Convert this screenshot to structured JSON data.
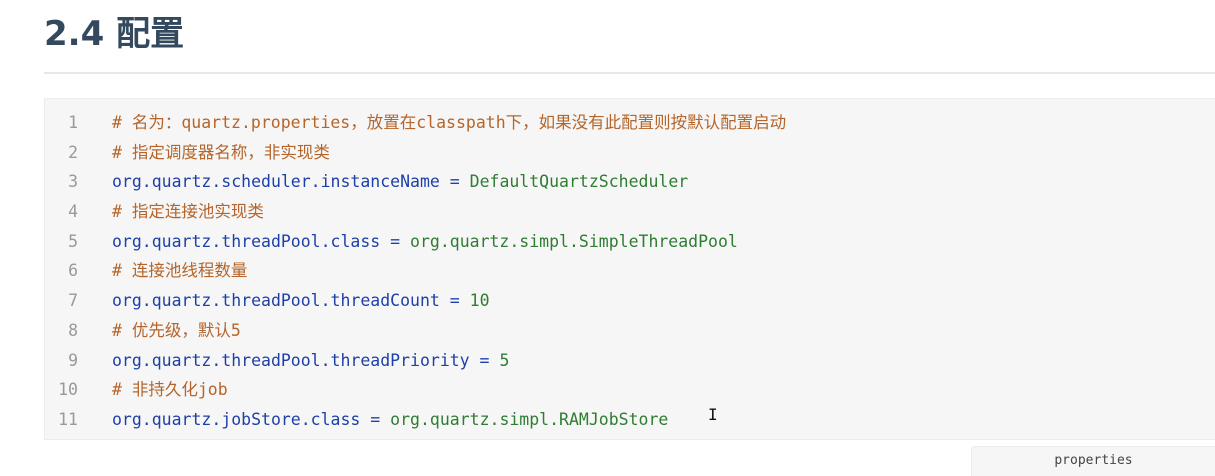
{
  "heading": {
    "title": "2.4 配置"
  },
  "code_block": {
    "language_label": "properties",
    "lines": [
      {
        "number": "1",
        "kind": "comment",
        "text": "# 名为：quartz.properties，放置在classpath下，如果没有此配置则按默认配置启动"
      },
      {
        "number": "2",
        "kind": "comment",
        "text": "# 指定调度器名称，非实现类"
      },
      {
        "number": "3",
        "kind": "property",
        "key": "org.quartz.scheduler.instanceName",
        "op": " = ",
        "value": "DefaultQuartzScheduler"
      },
      {
        "number": "4",
        "kind": "comment",
        "text": "# 指定连接池实现类"
      },
      {
        "number": "5",
        "kind": "property",
        "key": "org.quartz.threadPool.class",
        "op": " = ",
        "value": "org.quartz.simpl.SimpleThreadPool"
      },
      {
        "number": "6",
        "kind": "comment",
        "text": "# 连接池线程数量"
      },
      {
        "number": "7",
        "kind": "property",
        "key": "org.quartz.threadPool.threadCount",
        "op": " = ",
        "value": "10"
      },
      {
        "number": "8",
        "kind": "comment",
        "text": "# 优先级，默认5"
      },
      {
        "number": "9",
        "kind": "property",
        "key": "org.quartz.threadPool.threadPriority",
        "op": " = ",
        "value": "5"
      },
      {
        "number": "10",
        "kind": "comment",
        "text": "# 非持久化job"
      },
      {
        "number": "11",
        "kind": "property",
        "key": "org.quartz.jobStore.class",
        "op": " = ",
        "value": "org.quartz.simpl.RAMJobStore"
      }
    ]
  },
  "colors": {
    "heading": "#34495e",
    "comment": "#b5652b",
    "key": "#1d3fa8",
    "value": "#2e7d32",
    "line_number": "#999999",
    "code_background": "#f6f6f6"
  },
  "icons": {
    "cursor": "text-cursor-icon"
  }
}
